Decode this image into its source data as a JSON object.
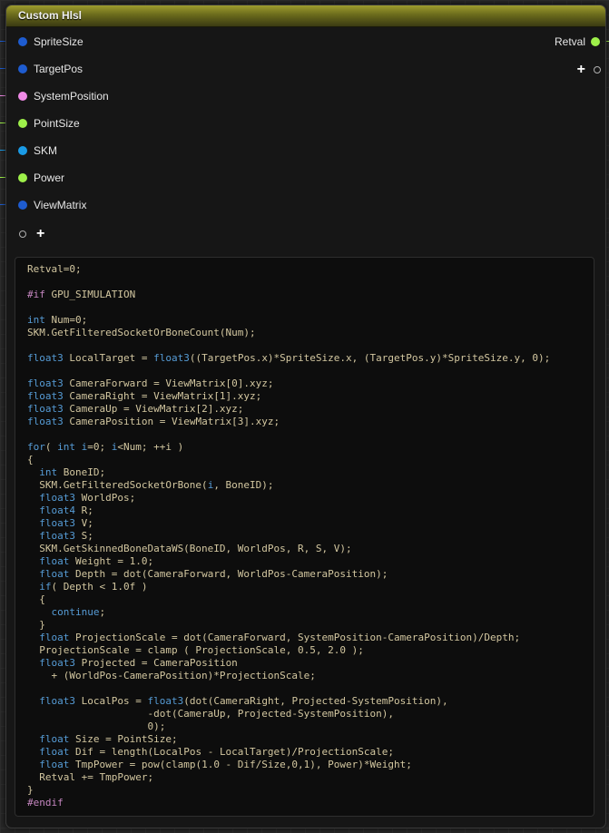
{
  "node": {
    "title": "Custom Hlsl",
    "header_color": "#7d7b22",
    "inputs": [
      {
        "label": "SpriteSize",
        "color": "#1e5cd0"
      },
      {
        "label": "TargetPos",
        "color": "#1e5cd0"
      },
      {
        "label": "SystemPosition",
        "color": "#f08ae6"
      },
      {
        "label": "PointSize",
        "color": "#9ef04a"
      },
      {
        "label": "SKM",
        "color": "#1a9be6"
      },
      {
        "label": "Power",
        "color": "#9ef04a"
      },
      {
        "label": "ViewMatrix",
        "color": "#1e5cd0"
      }
    ],
    "outputs": [
      {
        "label": "Retval",
        "color": "#9ef04a"
      }
    ],
    "add_pin_icon": "plus-icon",
    "exec_pin_icon": "ring-icon"
  },
  "code": [
    "Retval=0;",
    "",
    "#if GPU_SIMULATION",
    "",
    "int Num=0;",
    "SKM.GetFilteredSocketOrBoneCount(Num);",
    "",
    "float3 LocalTarget = float3((TargetPos.x)*SpriteSize.x, (TargetPos.y)*SpriteSize.y, 0);",
    "",
    "float3 CameraForward = ViewMatrix[0].xyz;",
    "float3 CameraRight = ViewMatrix[1].xyz;",
    "float3 CameraUp = ViewMatrix[2].xyz;",
    "float3 CameraPosition = ViewMatrix[3].xyz;",
    "",
    "for( int i=0; i<Num; ++i )",
    "{",
    "  int BoneID;",
    "  SKM.GetFilteredSocketOrBone(i, BoneID);",
    "  float3 WorldPos;",
    "  float4 R;",
    "  float3 V;",
    "  float3 S;",
    "  SKM.GetSkinnedBoneDataWS(BoneID, WorldPos, R, S, V);",
    "  float Weight = 1.0;",
    "  float Depth = dot(CameraForward, WorldPos-CameraPosition);",
    "  if( Depth < 1.0f )",
    "  {",
    "    continue;",
    "  }",
    "  float ProjectionScale = dot(CameraForward, SystemPosition-CameraPosition)/Depth;",
    "  ProjectionScale = clamp ( ProjectionScale, 0.5, 2.0 );",
    "  float3 Projected = CameraPosition",
    "    + (WorldPos-CameraPosition)*ProjectionScale;",
    "",
    "  float3 LocalPos = float3(dot(CameraRight, Projected-SystemPosition),",
    "                    -dot(CameraUp, Projected-SystemPosition),",
    "                    0);",
    "  float Size = PointSize;",
    "  float Dif = length(LocalPos - LocalTarget)/ProjectionScale;",
    "  float TmpPower = pow(clamp(1.0 - Dif/Size,0,1), Power)*Weight;",
    "  Retval += TmpPower;",
    "}",
    "#endif"
  ],
  "syntax_colors": {
    "keyword": "#569cd6",
    "preprocessor": "#c586c0",
    "text": "#d3c7a0"
  }
}
